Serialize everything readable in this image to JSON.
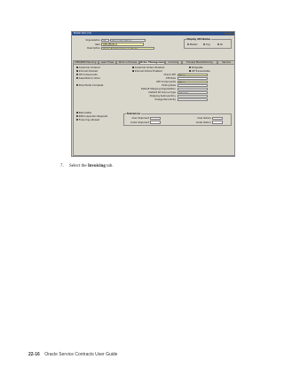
{
  "window": {
    "title": "Master Item (V1)"
  },
  "header": {
    "organization_label": "Organization",
    "organization_code": "V1",
    "organization_name": "Vision Operations",
    "item_label": "Item",
    "item_value": "OPS-PROD-0",
    "description_label": "Description",
    "description_value": "Usage Item for Sales problems",
    "display_attributes": {
      "title": "Display Attributes",
      "options": [
        "Master",
        "Org",
        "All"
      ]
    }
  },
  "tabs": [
    "MPS/MRP Planning",
    "Lead Times",
    "Work in Process",
    "Order Management",
    "Invoicing",
    "Process Manufacturing",
    "Service"
  ],
  "active_tab_index": 3,
  "order_mgmt": {
    "left_checks": [
      {
        "label": "Customer Ordered",
        "checked": true
      },
      {
        "label": "Internal Ordered",
        "checked": true
      },
      {
        "label": "OE Components",
        "checked": false
      },
      {
        "label": "Assemble to Order",
        "checked": false
      }
    ],
    "ship_model_label": "Ship Model Complete",
    "ship_model_checked": false,
    "returnable": [
      {
        "label": "Returnable",
        "checked": true
      },
      {
        "label": "RMA Inspection Required",
        "checked": false
      },
      {
        "label": "Financing Allowed",
        "checked": false
      }
    ],
    "right_checks": [
      {
        "label": "Customer Orders Enabled",
        "checked": true
      },
      {
        "label": "Internal Orders Enabled",
        "checked": true
      }
    ],
    "shippable": {
      "label": "Shippable",
      "checked": false
    },
    "oe_transactable": {
      "label": "OE Transactable",
      "checked": true
    },
    "fields": [
      {
        "label": "Check ATP",
        "value": "None",
        "req": true
      },
      {
        "label": "ATP Rule",
        "value": "",
        "req": false
      },
      {
        "label": "ATP Components",
        "value": "None",
        "req": true
      },
      {
        "label": "Picking Rule",
        "value": "",
        "req": false
      },
      {
        "label": "Default Shipping Organization",
        "value": "",
        "req": false
      },
      {
        "label": "Default SO Source Type",
        "value": "Internal",
        "req": false
      },
      {
        "label": "Shipping Subinventory",
        "value": "",
        "req": false
      },
      {
        "label": "Charge Periodicity",
        "value": "",
        "req": false
      }
    ],
    "tolerances": {
      "title": "Tolerances",
      "over_shipment": "Over Shipment",
      "under_shipment": "Under Shipment",
      "over_return": "Over Return",
      "under_return": "Under Return"
    }
  },
  "instruction": {
    "number": "7.",
    "prefix": "Select the ",
    "bold": "Invoicing",
    "suffix": " tab."
  },
  "footer": {
    "page": "22-16",
    "title": "Oracle Service Contracts User Guide"
  }
}
